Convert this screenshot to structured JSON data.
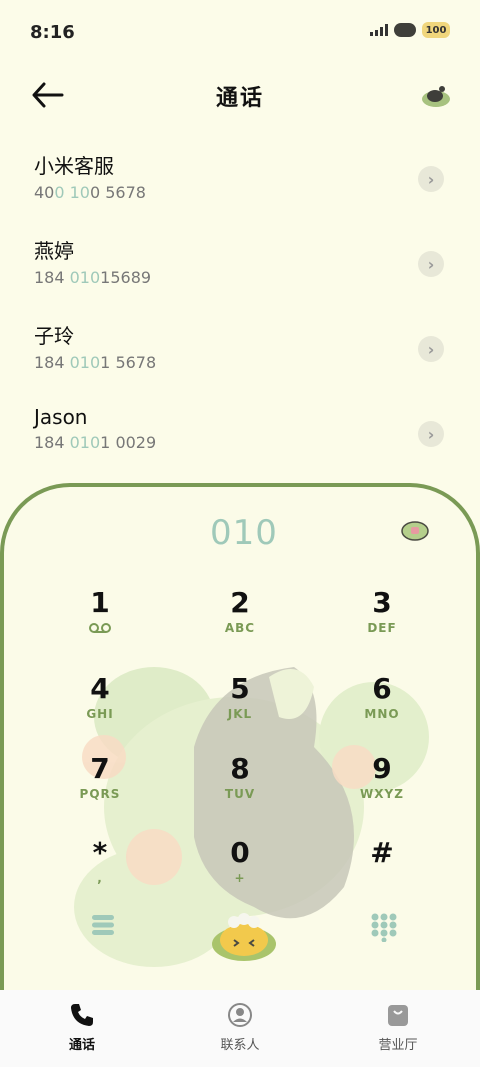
{
  "status": {
    "time": "8:16",
    "battery": "100"
  },
  "header": {
    "title": "通话"
  },
  "contacts": [
    {
      "name": "小米客服",
      "num_a": "40",
      "num_b": "0 10",
      "num_c": "0 5678"
    },
    {
      "name": "燕婷",
      "num_a": "184 ",
      "num_b": "010",
      "num_c": "15689"
    },
    {
      "name": "子玲",
      "num_a": "184 ",
      "num_b": "010",
      "num_c": "1 5678"
    },
    {
      "name": "Jason",
      "num_a": "184 ",
      "num_b": "010",
      "num_c": "1 0029"
    }
  ],
  "dialpad": {
    "input": "010",
    "keys": [
      {
        "digit": "1",
        "letters": ""
      },
      {
        "digit": "2",
        "letters": "ABC"
      },
      {
        "digit": "3",
        "letters": "DEF"
      },
      {
        "digit": "4",
        "letters": "GHI"
      },
      {
        "digit": "5",
        "letters": "JKL"
      },
      {
        "digit": "6",
        "letters": "MNO"
      },
      {
        "digit": "7",
        "letters": "PQRS"
      },
      {
        "digit": "8",
        "letters": "TUV"
      },
      {
        "digit": "9",
        "letters": "WXYZ"
      },
      {
        "digit": "*",
        "letters": ","
      },
      {
        "digit": "0",
        "letters": "+"
      },
      {
        "digit": "#",
        "letters": ""
      }
    ]
  },
  "nav": [
    {
      "label": "通话",
      "icon": "phone-icon",
      "active": true
    },
    {
      "label": "联系人",
      "icon": "person-icon",
      "active": false
    },
    {
      "label": "营业厅",
      "icon": "bag-icon",
      "active": false
    }
  ],
  "colors": {
    "accent": "#7a9a55",
    "highlight": "#9fc9b9",
    "background": "#fcfce9"
  }
}
